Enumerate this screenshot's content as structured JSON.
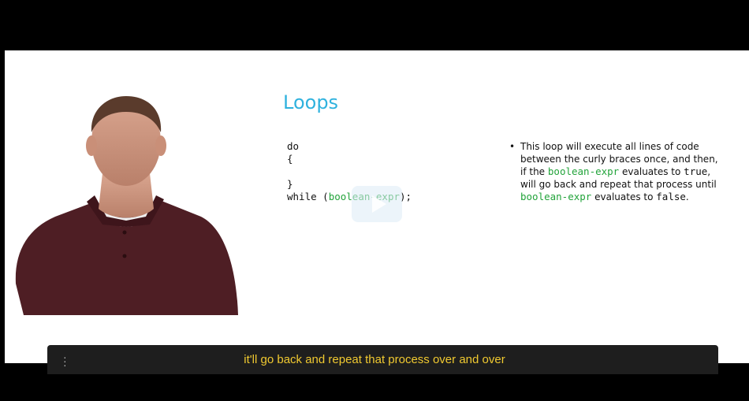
{
  "slide": {
    "title": "Loops",
    "code": {
      "line1": "do",
      "line2": "{",
      "line3": "",
      "line4": "}",
      "line5_pre": "while (",
      "line5_expr": "boolean-expr",
      "line5_post": ");"
    },
    "bullet": {
      "t1": "This loop will execute all lines of code between the curly braces once, and then, if the ",
      "code1": "boolean-expr",
      "t2": " evaluates to ",
      "code2": "true",
      "t3": ", will go back and repeat that process until ",
      "code3": "boolean-expr",
      "t4": " evaluates to ",
      "code4": "false",
      "t5": "."
    }
  },
  "player": {
    "caption": "it'll go back and repeat that process over and over",
    "play_icon": "play-icon",
    "menu_icon": "more-vertical-icon"
  },
  "colors": {
    "title": "#2fb2de",
    "code_highlight": "#22a33a",
    "caption": "#f0c930"
  }
}
